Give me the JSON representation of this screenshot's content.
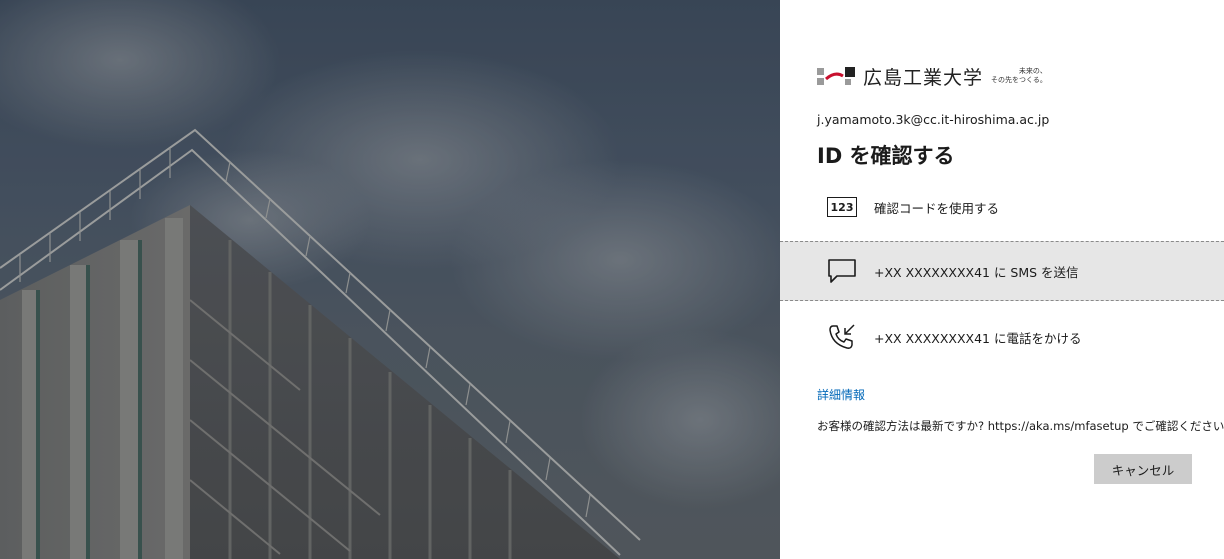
{
  "background": {
    "image_name": "building-photo"
  },
  "branding": {
    "org_name": "広島工業大学",
    "tagline_line1": "未来の、",
    "tagline_line2": "その先をつくる。"
  },
  "auth": {
    "email": "j.yamamoto.3k@cc.it-hiroshima.ac.jp",
    "title": "ID を確認する"
  },
  "options": [
    {
      "icon": "verification-code-icon",
      "icon_text": "123",
      "label": "確認コードを使用する"
    },
    {
      "icon": "sms-icon",
      "label": "+XX XXXXXXXX41 に SMS を送信"
    },
    {
      "icon": "phone-call-icon",
      "label": "+XX XXXXXXXX41 に電話をかける"
    }
  ],
  "links": {
    "more_info": "詳細情報"
  },
  "note": "お客様の確認方法は最新ですか? https://aka.ms/mfasetup でご確認ください",
  "buttons": {
    "cancel": "キャンセル"
  },
  "colors": {
    "link": "#0067b8",
    "selected_option_bg": "#e6e6e6",
    "cancel_button_bg": "#cccccc"
  }
}
